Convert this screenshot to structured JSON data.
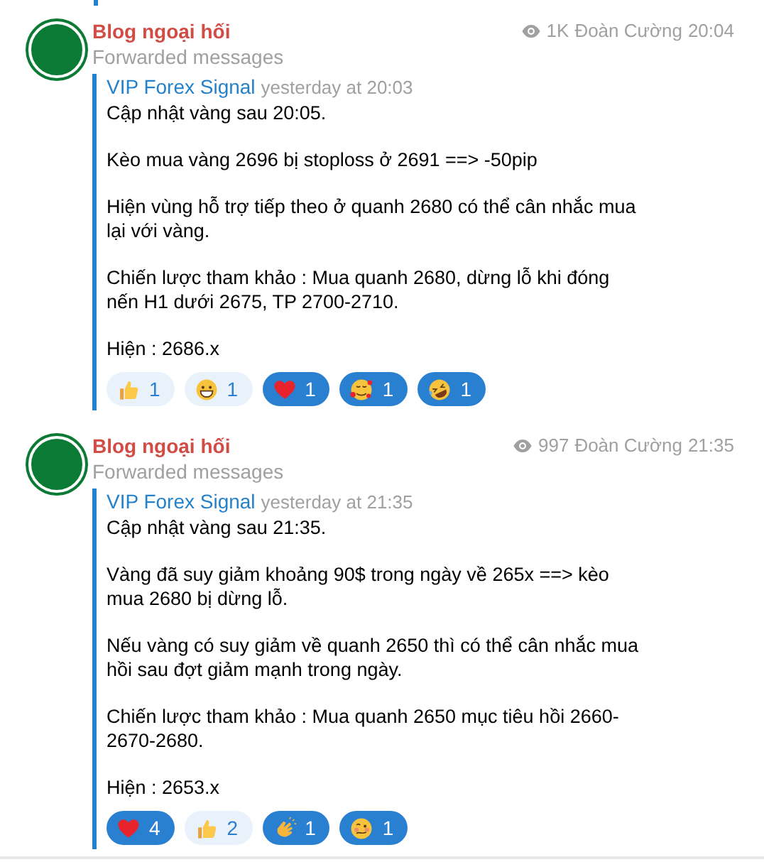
{
  "messages": [
    {
      "channel": "Blog ngoại hối",
      "subtitle": "Forwarded messages",
      "views": "1K",
      "author": "Đoàn Cường",
      "time": "20:04",
      "forward": {
        "source": "VIP Forex Signal",
        "time": "yesterday at 20:03",
        "paragraphs": [
          "Cập nhật vàng sau 20:05.",
          "Kèo mua vàng 2696 bị stoploss ở 2691 ==> -50pip",
          "Hiện vùng hỗ trợ tiếp theo ở quanh 2680 có thể cân nhắc mua lại với vàng.",
          "Chiến lược tham khảo : Mua quanh 2680, dừng lỗ khi đóng nến H1 dưới 2675, TP 2700-2710.",
          "Hiện : 2686.x"
        ]
      },
      "reactions": [
        {
          "kind": "thumbs_up",
          "count": "1",
          "selected": false
        },
        {
          "kind": "grin",
          "count": "1",
          "selected": false
        },
        {
          "kind": "heart",
          "count": "1",
          "selected": true
        },
        {
          "kind": "hearts_face",
          "count": "1",
          "selected": true
        },
        {
          "kind": "laugh",
          "count": "1",
          "selected": true
        }
      ]
    },
    {
      "channel": "Blog ngoại hối",
      "subtitle": "Forwarded messages",
      "views": "997",
      "author": "Đoàn Cường",
      "time": "21:35",
      "forward": {
        "source": "VIP Forex Signal",
        "time": "yesterday at 21:35",
        "paragraphs": [
          "Cập nhật vàng sau 21:35.",
          "Vàng đã suy giảm khoảng 90$ trong ngày về 265x ==> kèo mua 2680 bị dừng lỗ.",
          "Nếu vàng có suy giảm về quanh 2650 thì có thể cân nhắc mua hồi sau đợt giảm mạnh trong ngày.",
          "Chiến lược tham khảo : Mua quanh 2650 mục tiêu hồi 2660-2670-2680.",
          "Hiện : 2653.x"
        ]
      },
      "reactions": [
        {
          "kind": "heart",
          "count": "4",
          "selected": true
        },
        {
          "kind": "thumbs_up",
          "count": "2",
          "selected": false
        },
        {
          "kind": "clap",
          "count": "1",
          "selected": true
        },
        {
          "kind": "woozy",
          "count": "1",
          "selected": true
        }
      ]
    }
  ]
}
